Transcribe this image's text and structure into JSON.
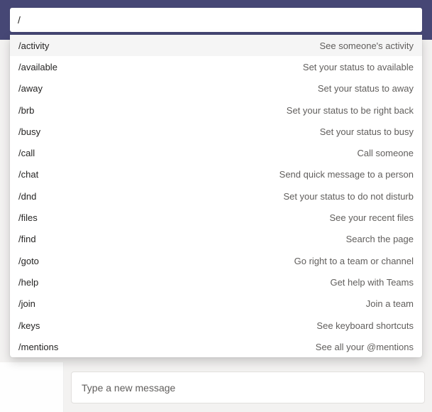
{
  "search": {
    "value": "/"
  },
  "commands": [
    {
      "cmd": "/activity",
      "desc": "See someone's activity",
      "hl": true
    },
    {
      "cmd": "/available",
      "desc": "Set your status to available",
      "hl": false
    },
    {
      "cmd": "/away",
      "desc": "Set your status to away",
      "hl": false
    },
    {
      "cmd": "/brb",
      "desc": "Set your status to be right back",
      "hl": false
    },
    {
      "cmd": "/busy",
      "desc": "Set your status to busy",
      "hl": false
    },
    {
      "cmd": "/call",
      "desc": "Call someone",
      "hl": false
    },
    {
      "cmd": "/chat",
      "desc": "Send quick message to a person",
      "hl": false
    },
    {
      "cmd": "/dnd",
      "desc": "Set your status to do not disturb",
      "hl": false
    },
    {
      "cmd": "/files",
      "desc": "See your recent files",
      "hl": false
    },
    {
      "cmd": "/find",
      "desc": "Search the page",
      "hl": false
    },
    {
      "cmd": "/goto",
      "desc": "Go right to a team or channel",
      "hl": false
    },
    {
      "cmd": "/help",
      "desc": "Get help with Teams",
      "hl": false
    },
    {
      "cmd": "/join",
      "desc": "Join a team",
      "hl": false
    },
    {
      "cmd": "/keys",
      "desc": "See keyboard shortcuts",
      "hl": false
    },
    {
      "cmd": "/mentions",
      "desc": "See all your @mentions",
      "hl": false
    }
  ],
  "compose": {
    "placeholder": "Type a new message"
  }
}
